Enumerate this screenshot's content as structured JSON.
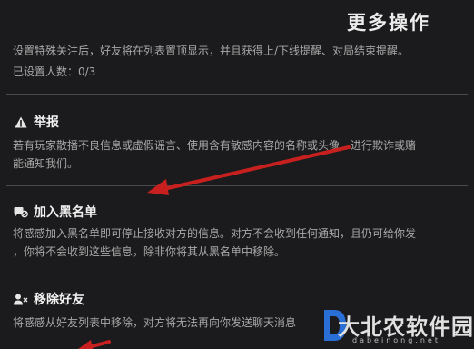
{
  "header": {
    "title": "更多操作"
  },
  "special_follow": {
    "description": "设置特殊关注后，好友将在列表置顶显示，并且获得上/下线提醒、对局结束提醒。",
    "count": "已设置人数：0/3"
  },
  "report": {
    "label": "举报",
    "icon": "warning-icon",
    "description_line1": "若有玩家散播不良信息或虚假谣言、使用含有敏感内容的名称或头像、进行欺诈或赌",
    "description_line2": "能通知我们。"
  },
  "blacklist": {
    "label": "加入黑名单",
    "icon": "block-chat-icon",
    "description_line1": "将感感加入黑名单即可停止接收对方的信息。对方不会收到任何通知，且仍可给你发",
    "description_line2": "，你将不会收到这些信息，除非你将其从黑名单中移除。"
  },
  "remove_friend": {
    "label": "移除好友",
    "icon": "remove-user-icon",
    "description_line1": "将感感从好友列表中移除，对方将无法再向你发送聊天消息"
  },
  "watermark": {
    "text": "大北农软件园",
    "sub": "dabeinong.net"
  },
  "colors": {
    "background": "#1b1b1d",
    "arrow": "#c8201e",
    "divider": "#4a4a4c"
  }
}
